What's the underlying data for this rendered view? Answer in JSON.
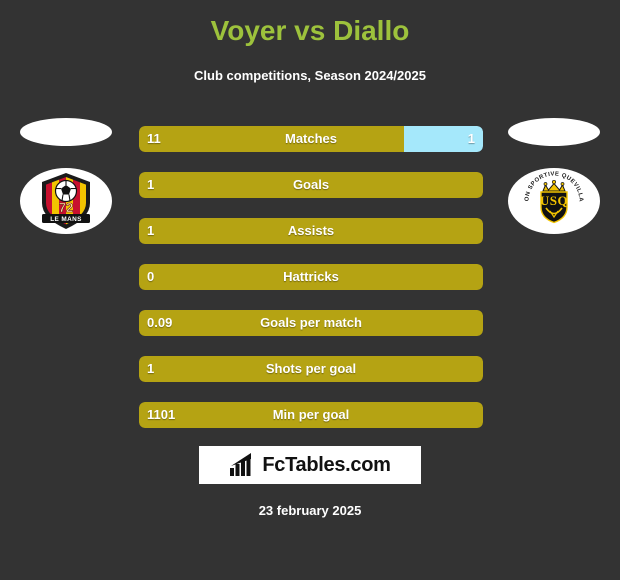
{
  "header": {
    "title": "Voyer vs Diallo",
    "subtitle": "Club competitions, Season 2024/2025",
    "title_color": "#9dc23c"
  },
  "teams": {
    "home": {
      "crest_name": "le-mans-fc-crest",
      "crest_number": "72",
      "crest_text": "LE MANS"
    },
    "away": {
      "crest_name": "us-quevilly-crest",
      "crest_text": "UNION SPORTIVE QUEVILLAISE",
      "crest_monogram": "USQ"
    }
  },
  "colors": {
    "background": "#333333",
    "home_bar": "#b5a313",
    "away_bar": "#a5e8fb",
    "accent_green": "#9dc23c"
  },
  "chart_data": {
    "type": "bar",
    "title": "Voyer vs Diallo",
    "subtitle": "Club competitions, Season 2024/2025",
    "orientation": "horizontal-stacked",
    "categories": [
      "Matches",
      "Goals",
      "Assists",
      "Hattricks",
      "Goals per match",
      "Shots per goal",
      "Min per goal"
    ],
    "series": [
      {
        "name": "Voyer",
        "color": "#b5a313",
        "values": [
          "11",
          "1",
          "1",
          "0",
          "0.09",
          "1",
          "1101"
        ]
      },
      {
        "name": "Diallo",
        "color": "#a5e8fb",
        "values": [
          "1",
          "",
          "",
          "",
          "",
          "",
          ""
        ]
      }
    ],
    "grid": false,
    "legend": "none"
  },
  "stats": [
    {
      "label": "Matches",
      "home": "11",
      "away": "1",
      "home_pct": 77,
      "away_pct": 23
    },
    {
      "label": "Goals",
      "home": "1",
      "away": "",
      "home_pct": 100,
      "away_pct": 0
    },
    {
      "label": "Assists",
      "home": "1",
      "away": "",
      "home_pct": 100,
      "away_pct": 0
    },
    {
      "label": "Hattricks",
      "home": "0",
      "away": "",
      "home_pct": 100,
      "away_pct": 0
    },
    {
      "label": "Goals per match",
      "home": "0.09",
      "away": "",
      "home_pct": 100,
      "away_pct": 0
    },
    {
      "label": "Shots per goal",
      "home": "1",
      "away": "",
      "home_pct": 100,
      "away_pct": 0
    },
    {
      "label": "Min per goal",
      "home": "1101",
      "away": "",
      "home_pct": 100,
      "away_pct": 0
    }
  ],
  "footer": {
    "brand": "FcTables.com",
    "brand_icon": "bar-chart-arrow-icon",
    "date": "23 february 2025"
  }
}
